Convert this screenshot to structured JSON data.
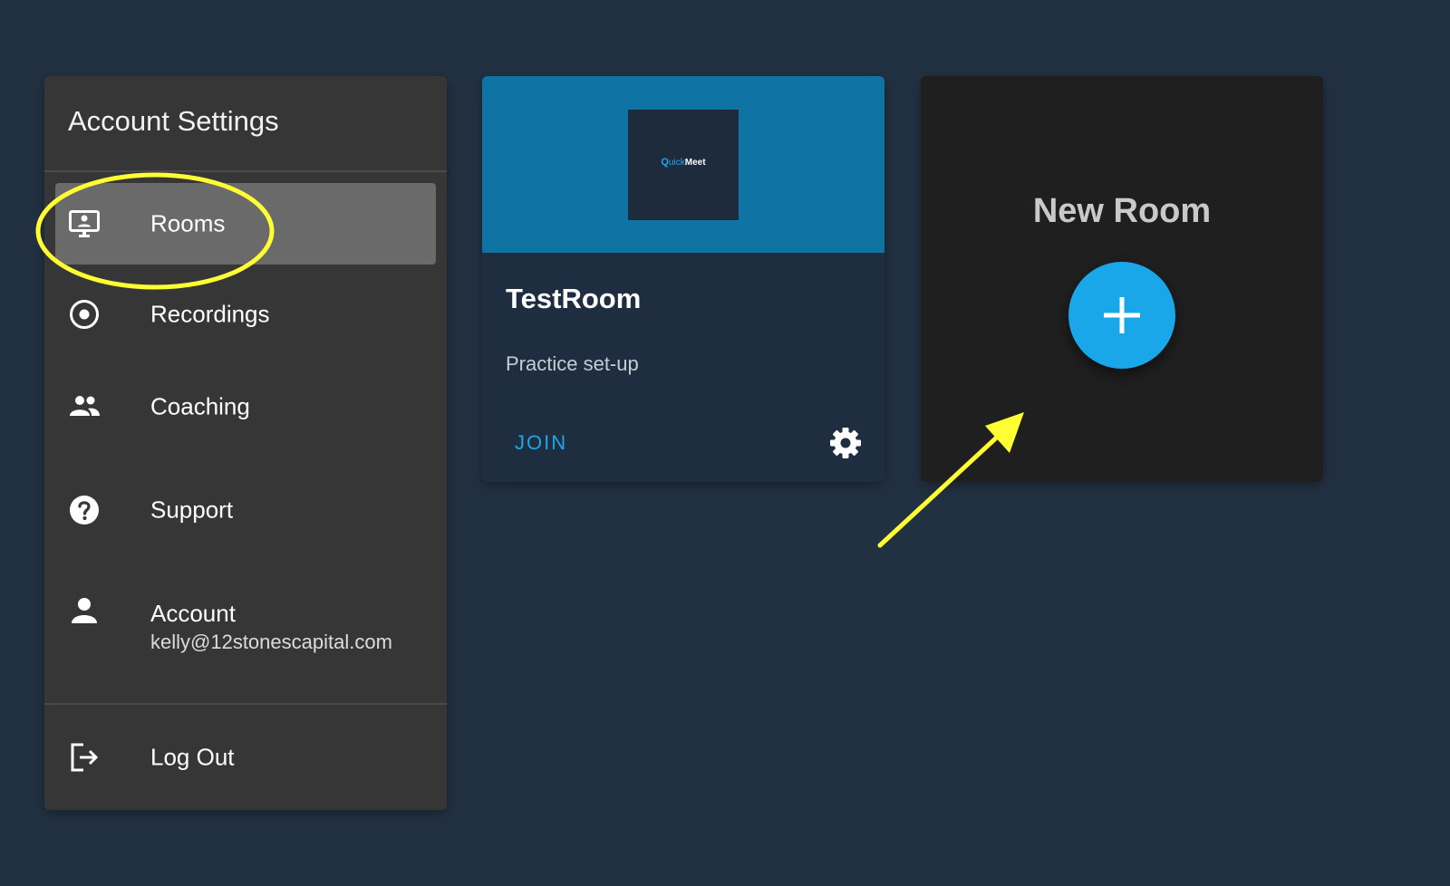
{
  "sidebar": {
    "title": "Account Settings",
    "items": [
      {
        "label": "Rooms",
        "icon": "monitor-person-icon"
      },
      {
        "label": "Recordings",
        "icon": "record-icon"
      },
      {
        "label": "Coaching",
        "icon": "people-icon"
      },
      {
        "label": "Support",
        "icon": "help-icon"
      },
      {
        "label": "Account",
        "sublabel": "kelly@12stonescapital.com",
        "icon": "person-icon"
      },
      {
        "label": "Log Out",
        "icon": "logout-icon"
      }
    ],
    "active_item": "Rooms"
  },
  "room_card": {
    "logo": {
      "q": "Q",
      "uick": "uick",
      "meet": "Meet"
    },
    "name": "TestRoom",
    "description": "Practice set-up",
    "join_label": "JOIN",
    "settings_icon": "gear-icon"
  },
  "new_room_card": {
    "title": "New Room",
    "add_icon": "plus-icon"
  },
  "colors": {
    "background": "#223142",
    "panel": "#363636",
    "active_item": "#6a6a6a",
    "room_header": "#0f73a3",
    "accent": "#1ea7e6",
    "annotation": "#ffff33"
  }
}
